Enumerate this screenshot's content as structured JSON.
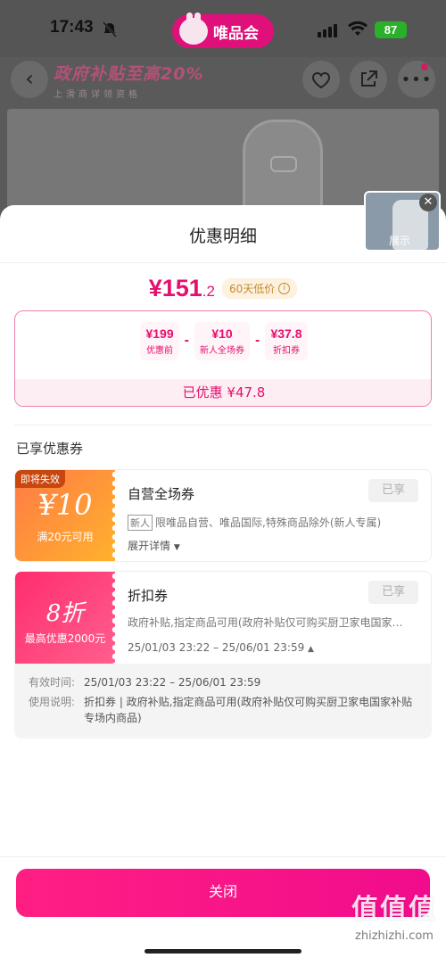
{
  "status_bar": {
    "time": "17:43",
    "battery": "87"
  },
  "brand": {
    "name": "唯品会"
  },
  "banner": {
    "title": "政府补贴至高20%",
    "subtitle": "上滑商详领资格"
  },
  "video_thumb": {
    "label": "展示"
  },
  "sheet": {
    "title": "优惠明细",
    "price_main": "¥151",
    "price_decimal": ".2",
    "low_price_badge": "60天低价",
    "calc": [
      {
        "value": "¥199",
        "label": "优惠前"
      },
      {
        "value": "¥10",
        "label": "新人全场券"
      },
      {
        "value": "¥37.8",
        "label": "折扣券"
      }
    ],
    "op_minus": "-",
    "saved_text": "已优惠 ¥47.8",
    "section_title": "已享优惠券"
  },
  "coupons": [
    {
      "tag": "即将失效",
      "amount": "¥10",
      "condition": "满20元可用",
      "name": "自营全场券",
      "claimed": "已享",
      "badge": "新人",
      "desc": "限唯品自营、唯品国际,特殊商品除外(新人专属)",
      "more": "展开详情"
    },
    {
      "amount": "8折",
      "condition": "最高优惠2000元",
      "name": "折扣券",
      "claimed": "已享",
      "desc": "政府补贴,指定商品可用(政府补贴仅可购买厨卫家电国家…",
      "dates": "25/01/03 23:22 – 25/06/01 23:59"
    }
  ],
  "detail": {
    "valid_label": "有效时间:",
    "valid_value": "25/01/03 23:22 – 25/06/01 23:59",
    "usage_label": "使用说明:",
    "usage_value": "折扣券 | 政府补贴,指定商品可用(政府补贴仅可购买厨卫家电国家补贴专场内商品)"
  },
  "close_label": "关闭",
  "watermark": {
    "big": "值值值",
    "small": "zhizhizhi.com"
  },
  "colors": {
    "accent": "#e5106e",
    "brand": "#e0107a"
  }
}
